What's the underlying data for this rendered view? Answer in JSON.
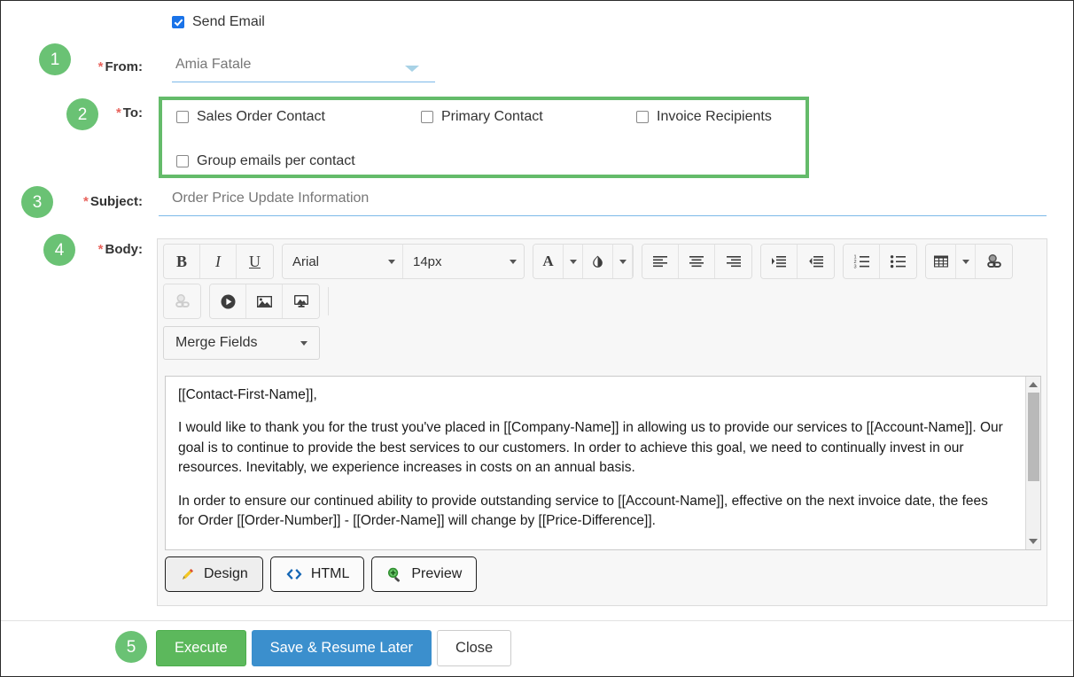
{
  "steps": [
    {
      "number": "1",
      "for": "from"
    },
    {
      "number": "2",
      "for": "to"
    },
    {
      "number": "3",
      "for": "subject"
    },
    {
      "number": "4",
      "for": "body"
    },
    {
      "number": "5",
      "for": "actions"
    }
  ],
  "send_email": {
    "label": "Send Email",
    "checked": true
  },
  "from": {
    "required_marker": "*",
    "label": "From:",
    "value": "Amia Fatale",
    "caret_icon": "chevron-down-icon"
  },
  "to": {
    "required_marker": "*",
    "label": "To:",
    "options": [
      {
        "label": "Sales Order Contact",
        "checked": false
      },
      {
        "label": "Primary Contact",
        "checked": false
      },
      {
        "label": "Invoice Recipients",
        "checked": false
      },
      {
        "label": "Group emails per contact",
        "checked": false
      }
    ],
    "highlight_color": "#64bb6a"
  },
  "subject": {
    "required_marker": "*",
    "label": "Subject:",
    "value": "Order Price Update Information"
  },
  "body": {
    "required_marker": "*",
    "label": "Body:",
    "toolbar_row1": [
      {
        "name": "bold-button",
        "glyph": "B",
        "style": "bold-i"
      },
      {
        "name": "italic-button",
        "glyph": "I",
        "style": "ital-i"
      },
      {
        "name": "underline-button",
        "glyph": "U",
        "style": "und-i"
      }
    ],
    "font_family": {
      "label": "Arial",
      "caret_icon": "chevron-down-icon"
    },
    "font_size": {
      "label": "14px",
      "caret_icon": "chevron-down-icon"
    },
    "text_color": {
      "name": "text-color-button",
      "glyph": "A"
    },
    "highlight_color": {
      "name": "highlight-color-button",
      "glyph": "drop"
    },
    "align_buttons": [
      "align-left-icon",
      "align-center-icon",
      "align-right-icon"
    ],
    "indent_buttons": [
      "indent-increase-icon",
      "indent-decrease-icon"
    ],
    "list_buttons": [
      "ordered-list-icon",
      "unordered-list-icon"
    ],
    "table_button": "table-icon",
    "link_button": "insert-link-icon",
    "row2_buttons": [
      "unlink-icon",
      "insert-video-icon",
      "insert-image-icon",
      "insert-media-icon"
    ],
    "merge_fields": {
      "label": "Merge Fields",
      "caret_icon": "chevron-down-icon"
    },
    "content_paragraphs": [
      "[[Contact-First-Name]],",
      "I would like to thank you for the trust you've placed in [[Company-Name]] in allowing us to provide our services to [[Account-Name]]. Our goal is to continue to provide the best services to our customers. In order to achieve this goal, we need to continually invest in our resources. Inevitably, we experience increases in costs on an annual basis.",
      "In order to ensure our continued ability to provide outstanding service to [[Account-Name]], effective on the next invoice date, the fees for Order [[Order-Number]] - [[Order-Name]] will change by [[Price-Difference]]."
    ],
    "view_tabs": [
      {
        "label": "Design",
        "icon": "pencil-icon",
        "active": true
      },
      {
        "label": "HTML",
        "icon": "code-icon",
        "active": false
      },
      {
        "label": "Preview",
        "icon": "magnifier-plus-icon",
        "active": false
      }
    ]
  },
  "actions": {
    "execute": {
      "label": "Execute",
      "color": "#5cb85c"
    },
    "save": {
      "label": "Save & Resume Later",
      "color": "#3b8fcd"
    },
    "close": {
      "label": "Close",
      "color": "#ffffff"
    }
  }
}
